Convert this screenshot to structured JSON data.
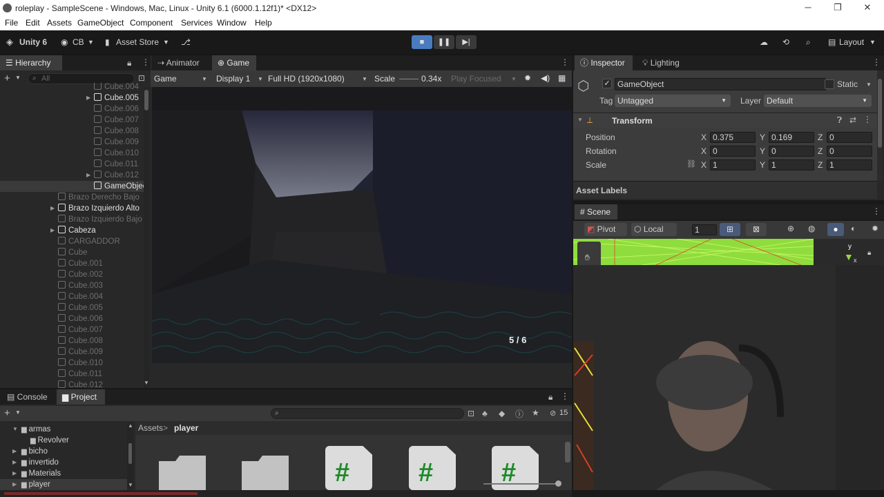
{
  "window": {
    "title": "roleplay - SampleScene - Windows, Mac, Linux - Unity 6.1 (6000.1.12f1)* <DX12>",
    "minimize": "─",
    "maximize": "❐",
    "close": "✕"
  },
  "menu": [
    "File",
    "Edit",
    "Assets",
    "GameObject",
    "Component",
    "Services",
    "Window",
    "Help"
  ],
  "toolbar": {
    "unity_label": "Unity 6",
    "account": "CB",
    "asset_store": "Asset Store",
    "layout": "Layout"
  },
  "hierarchy": {
    "tab": "Hierarchy",
    "search_placeholder": "All",
    "rows": [
      {
        "label": "Cube.004",
        "style": "dim",
        "indent": 1,
        "arrow": false
      },
      {
        "label": "Cube.005",
        "style": "bright",
        "indent": 1,
        "arrow": true
      },
      {
        "label": "Cube.006",
        "style": "dim",
        "indent": 1,
        "arrow": false
      },
      {
        "label": "Cube.007",
        "style": "dim",
        "indent": 1,
        "arrow": false
      },
      {
        "label": "Cube.008",
        "style": "dim",
        "indent": 1,
        "arrow": false
      },
      {
        "label": "Cube.009",
        "style": "dim",
        "indent": 1,
        "arrow": false
      },
      {
        "label": "Cube.010",
        "style": "dim",
        "indent": 1,
        "arrow": false
      },
      {
        "label": "Cube.011",
        "style": "dim",
        "indent": 1,
        "arrow": false
      },
      {
        "label": "Cube.012",
        "style": "dim",
        "indent": 1,
        "arrow": true
      },
      {
        "label": "GameObject",
        "style": "bright",
        "indent": 1,
        "arrow": false,
        "selected": true
      },
      {
        "label": "Brazo Derecho Bajo",
        "style": "dim",
        "indent": 0,
        "arrow": false
      },
      {
        "label": "Brazo Izquierdo Alto",
        "style": "bright",
        "indent": 0,
        "arrow": true
      },
      {
        "label": "Brazo Izquierdo Bajo",
        "style": "dim",
        "indent": 0,
        "arrow": false
      },
      {
        "label": "Cabeza",
        "style": "bright",
        "indent": 0,
        "arrow": true
      },
      {
        "label": "CARGADDOR",
        "style": "dim",
        "indent": 0,
        "arrow": false
      },
      {
        "label": "Cube",
        "style": "dim",
        "indent": 0,
        "arrow": false
      },
      {
        "label": "Cube.001",
        "style": "dim",
        "indent": 0,
        "arrow": false
      },
      {
        "label": "Cube.002",
        "style": "dim",
        "indent": 0,
        "arrow": false
      },
      {
        "label": "Cube.003",
        "style": "dim",
        "indent": 0,
        "arrow": false
      },
      {
        "label": "Cube.004",
        "style": "dim",
        "indent": 0,
        "arrow": false
      },
      {
        "label": "Cube.005",
        "style": "dim",
        "indent": 0,
        "arrow": false
      },
      {
        "label": "Cube.006",
        "style": "dim",
        "indent": 0,
        "arrow": false
      },
      {
        "label": "Cube.007",
        "style": "dim",
        "indent": 0,
        "arrow": false
      },
      {
        "label": "Cube.008",
        "style": "dim",
        "indent": 0,
        "arrow": false
      },
      {
        "label": "Cube.009",
        "style": "dim",
        "indent": 0,
        "arrow": false
      },
      {
        "label": "Cube.010",
        "style": "dim",
        "indent": 0,
        "arrow": false
      },
      {
        "label": "Cube.011",
        "style": "dim",
        "indent": 0,
        "arrow": false
      },
      {
        "label": "Cube.012",
        "style": "dim",
        "indent": 0,
        "arrow": false
      }
    ]
  },
  "game": {
    "tab_animator": "Animator",
    "tab_game": "Game",
    "mode": "Game",
    "display": "Display 1",
    "resolution": "Full HD (1920x1080)",
    "scale_label": "Scale",
    "scale_value": "0.34x",
    "play_focused": "Play Focused",
    "ammo": "5 / 6"
  },
  "inspector": {
    "tab_inspector": "Inspector",
    "tab_lighting": "Lighting",
    "object_name": "GameObject",
    "static_label": "Static",
    "tag_label": "Tag",
    "tag_value": "Untagged",
    "layer_label": "Layer",
    "layer_value": "Default",
    "transform_label": "Transform",
    "position_label": "Position",
    "rotation_label": "Rotation",
    "scale_label": "Scale",
    "position": {
      "x": "0.375",
      "y": "0.169",
      "z": "0"
    },
    "rotation": {
      "x": "0",
      "y": "0",
      "z": "0"
    },
    "scale": {
      "x": "1",
      "y": "1",
      "z": "1"
    },
    "axis_x": "X",
    "axis_y": "Y",
    "axis_z": "Z",
    "asset_labels": "Asset Labels"
  },
  "scene": {
    "tab": "Scene",
    "pivot": "Pivot",
    "local": "Local",
    "grid_value": "1",
    "gizmo_y": "y",
    "gizmo_x": "x"
  },
  "console": {
    "tab_console": "Console",
    "tab_project": "Project",
    "count": "15",
    "breadcrumb_root": "Assets",
    "breadcrumb_sep": ">",
    "breadcrumb_current": "player",
    "folders": [
      {
        "label": "armas",
        "indent": 1,
        "expanded": true
      },
      {
        "label": "Revolver",
        "indent": 2,
        "expanded": false
      },
      {
        "label": "bicho",
        "indent": 1,
        "expanded": false
      },
      {
        "label": "invertido",
        "indent": 1,
        "expanded": false
      },
      {
        "label": "Materials",
        "indent": 1,
        "expanded": false
      },
      {
        "label": "player",
        "indent": 1,
        "expanded": false,
        "selected": true
      }
    ]
  },
  "colors": {
    "accent": "#4a7bbf",
    "panel": "#282828",
    "scene_green": "#7bd33a"
  }
}
